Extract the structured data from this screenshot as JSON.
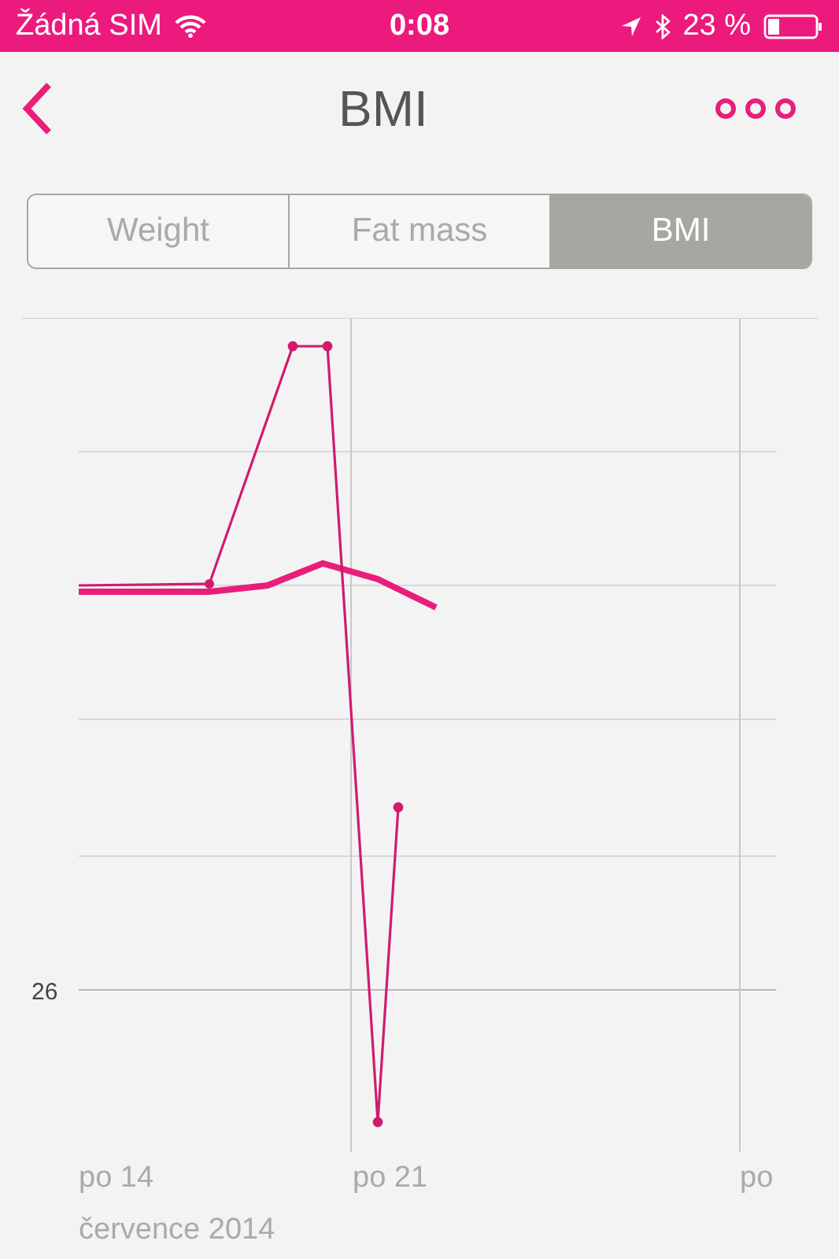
{
  "status_bar": {
    "carrier": "Žádná SIM",
    "time": "0:08",
    "battery": "23 %"
  },
  "nav": {
    "title": "BMI"
  },
  "segments": [
    {
      "label": "Weight",
      "selected": false
    },
    {
      "label": "Fat mass",
      "selected": false
    },
    {
      "label": "BMI",
      "selected": true
    }
  ],
  "chart": {
    "y_label": "26",
    "x_labels": [
      "po 14",
      "po 21",
      "po"
    ],
    "month": "července 2014"
  }
}
